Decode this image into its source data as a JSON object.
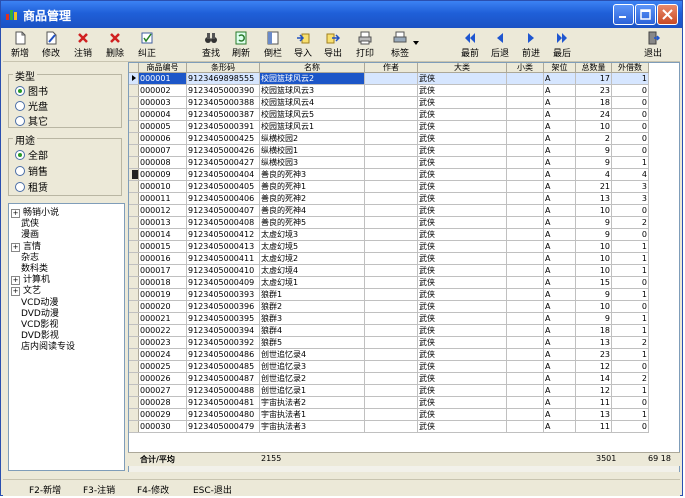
{
  "window": {
    "title": "商品管理"
  },
  "toolbar": {
    "left": [
      {
        "label": "新增",
        "icon": "new-document-icon"
      },
      {
        "label": "修改",
        "icon": "edit-pencil-icon"
      },
      {
        "label": "注销",
        "icon": "red-cross-icon"
      },
      {
        "label": "删除",
        "icon": "red-cross-icon"
      },
      {
        "label": "纠正",
        "icon": "checkbox-icon"
      }
    ],
    "mid": [
      {
        "label": "查找",
        "icon": "binoculars-icon"
      },
      {
        "label": "刷新",
        "icon": "refresh-icon"
      },
      {
        "label": "倒栏",
        "icon": "columns-icon"
      },
      {
        "label": "导入",
        "icon": "import-icon"
      },
      {
        "label": "导出",
        "icon": "export-icon"
      },
      {
        "label": "打印",
        "icon": "printer-icon"
      },
      {
        "label": "标签",
        "icon": "label-printer-icon"
      }
    ],
    "nav": [
      {
        "label": "最前",
        "icon": "first-arrow-icon"
      },
      {
        "label": "后退",
        "icon": "back-arrow-icon"
      },
      {
        "label": "前进",
        "icon": "forward-arrow-icon"
      },
      {
        "label": "最后",
        "icon": "last-arrow-icon"
      }
    ],
    "exit": {
      "label": "退出",
      "icon": "exit-door-icon"
    }
  },
  "category_group": {
    "legend": "类型",
    "options": [
      {
        "label": "图书",
        "checked": true
      },
      {
        "label": "光盘",
        "checked": false
      },
      {
        "label": "其它",
        "checked": false
      }
    ]
  },
  "usage_group": {
    "legend": "用途",
    "options": [
      {
        "label": "全部",
        "checked": true
      },
      {
        "label": "销售",
        "checked": false
      },
      {
        "label": "租赁",
        "checked": false
      }
    ]
  },
  "tree": [
    {
      "label": "畅销小说",
      "expandable": true,
      "indent": 0
    },
    {
      "label": "武侠",
      "expandable": false,
      "indent": 1
    },
    {
      "label": "漫画",
      "expandable": false,
      "indent": 1
    },
    {
      "label": "言情",
      "expandable": true,
      "indent": 0
    },
    {
      "label": "杂志",
      "expandable": false,
      "indent": 1
    },
    {
      "label": "数科类",
      "expandable": false,
      "indent": 1
    },
    {
      "label": "计算机",
      "expandable": true,
      "indent": 0
    },
    {
      "label": "文艺",
      "expandable": true,
      "indent": 0
    },
    {
      "label": "VCD动漫",
      "expandable": false,
      "indent": 1
    },
    {
      "label": "DVD动漫",
      "expandable": false,
      "indent": 1
    },
    {
      "label": "VCD影视",
      "expandable": false,
      "indent": 1
    },
    {
      "label": "DVD影视",
      "expandable": false,
      "indent": 1
    },
    {
      "label": "店内阅读专设",
      "expandable": false,
      "indent": 1
    }
  ],
  "grid": {
    "columns": [
      "商品编号",
      "条形码",
      "名称",
      "作者",
      "大类",
      "小类",
      "架位",
      "总数量",
      "外借数"
    ],
    "rows": [
      [
        "000001",
        "9123469898555",
        "校园篮球风云2",
        "",
        "武侠",
        "",
        "A",
        "17",
        "1"
      ],
      [
        "000002",
        "9123405000390",
        "校园篮球风云3",
        "",
        "武侠",
        "",
        "A",
        "23",
        "0"
      ],
      [
        "000003",
        "9123405000388",
        "校园篮球风云4",
        "",
        "武侠",
        "",
        "A",
        "18",
        "0"
      ],
      [
        "000004",
        "9123405000387",
        "校园篮球风云5",
        "",
        "武侠",
        "",
        "A",
        "24",
        "0"
      ],
      [
        "000005",
        "9123405000391",
        "校园篮球风云1",
        "",
        "武侠",
        "",
        "A",
        "10",
        "0"
      ],
      [
        "000006",
        "9123405000425",
        "纵横校园2",
        "",
        "武侠",
        "",
        "A",
        "2",
        "0"
      ],
      [
        "000007",
        "9123405000426",
        "纵横校园1",
        "",
        "武侠",
        "",
        "A",
        "9",
        "0"
      ],
      [
        "000008",
        "9123405000427",
        "纵横校园3",
        "",
        "武侠",
        "",
        "A",
        "9",
        "1"
      ],
      [
        "000009",
        "9123405000404",
        "善良的死神3",
        "",
        "武侠",
        "",
        "A",
        "4",
        "4"
      ],
      [
        "000010",
        "9123405000405",
        "善良的死神1",
        "",
        "武侠",
        "",
        "A",
        "21",
        "3"
      ],
      [
        "000011",
        "9123405000406",
        "善良的死神2",
        "",
        "武侠",
        "",
        "A",
        "13",
        "3"
      ],
      [
        "000012",
        "9123405000407",
        "善良的死神4",
        "",
        "武侠",
        "",
        "A",
        "10",
        "0"
      ],
      [
        "000013",
        "9123405000408",
        "善良的死神5",
        "",
        "武侠",
        "",
        "A",
        "9",
        "2"
      ],
      [
        "000014",
        "9123405000412",
        "太虚幻境3",
        "",
        "武侠",
        "",
        "A",
        "9",
        "0"
      ],
      [
        "000015",
        "9123405000413",
        "太虚幻境5",
        "",
        "武侠",
        "",
        "A",
        "10",
        "1"
      ],
      [
        "000016",
        "9123405000411",
        "太虚幻境2",
        "",
        "武侠",
        "",
        "A",
        "10",
        "1"
      ],
      [
        "000017",
        "9123405000410",
        "太虚幻境4",
        "",
        "武侠",
        "",
        "A",
        "10",
        "1"
      ],
      [
        "000018",
        "9123405000409",
        "太虚幻境1",
        "",
        "武侠",
        "",
        "A",
        "15",
        "0"
      ],
      [
        "000019",
        "9123405000393",
        "狼群1",
        "",
        "武侠",
        "",
        "A",
        "9",
        "1"
      ],
      [
        "000020",
        "9123405000396",
        "狼群2",
        "",
        "武侠",
        "",
        "A",
        "10",
        "0"
      ],
      [
        "000021",
        "9123405000395",
        "狼群3",
        "",
        "武侠",
        "",
        "A",
        "9",
        "1"
      ],
      [
        "000022",
        "9123405000394",
        "狼群4",
        "",
        "武侠",
        "",
        "A",
        "18",
        "1"
      ],
      [
        "000023",
        "9123405000392",
        "狼群5",
        "",
        "武侠",
        "",
        "A",
        "13",
        "2"
      ],
      [
        "000024",
        "9123405000486",
        "创世追忆录4",
        "",
        "武侠",
        "",
        "A",
        "23",
        "1"
      ],
      [
        "000025",
        "9123405000485",
        "创世追忆录3",
        "",
        "武侠",
        "",
        "A",
        "12",
        "0"
      ],
      [
        "000026",
        "9123405000487",
        "创世追忆录2",
        "",
        "武侠",
        "",
        "A",
        "14",
        "2"
      ],
      [
        "000027",
        "9123405000488",
        "创世追忆录1",
        "",
        "武侠",
        "",
        "A",
        "12",
        "1"
      ],
      [
        "000028",
        "9123405000481",
        "宇宙执法者2",
        "",
        "武侠",
        "",
        "A",
        "11",
        "0"
      ],
      [
        "000029",
        "9123405000480",
        "宇宙执法者1",
        "",
        "武侠",
        "",
        "A",
        "13",
        "1"
      ],
      [
        "000030",
        "9123405000479",
        "宇宙执法者3",
        "",
        "武侠",
        "",
        "A",
        "11",
        "0"
      ]
    ],
    "selected_index": 0,
    "current_index": 8
  },
  "totals": {
    "label": "合计/平均",
    "count": "2155",
    "total_qty": "3501",
    "lent": "69 18"
  },
  "status": [
    {
      "label": "F2-新增"
    },
    {
      "label": "F3-注销"
    },
    {
      "label": "F4-修改"
    },
    {
      "label": "ESC-退出"
    }
  ]
}
